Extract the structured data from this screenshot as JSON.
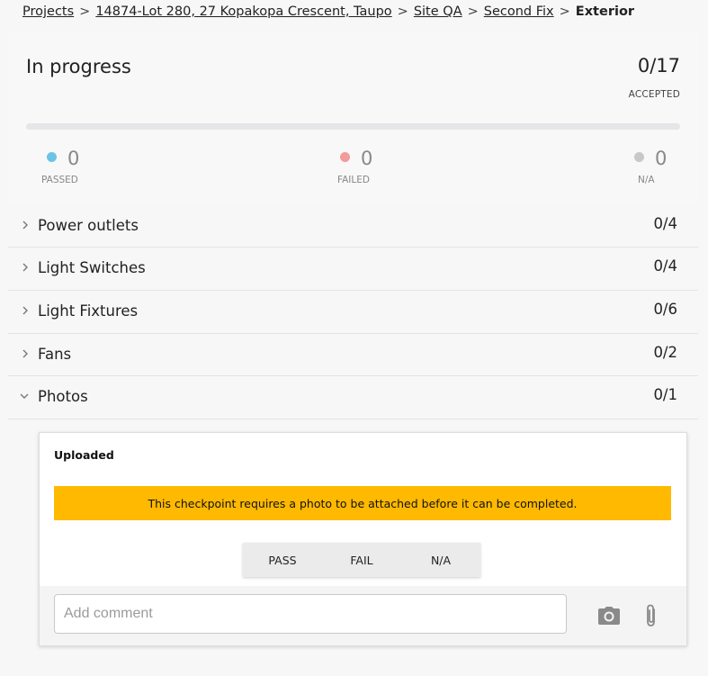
{
  "breadcrumb": {
    "items": [
      "Projects",
      "14874-Lot 280, 27 Kopakopa Crescent, Taupo",
      "Site QA",
      "Second Fix"
    ],
    "separator": ">",
    "current": "Exterior"
  },
  "summary": {
    "status": "In progress",
    "accepted_count": "0/17",
    "accepted_label": "ACCEPTED",
    "progress_fraction": 0,
    "stats": {
      "passed": {
        "value": "0",
        "label": "PASSED",
        "color": "#6cc4e4"
      },
      "failed": {
        "value": "0",
        "label": "FAILED",
        "color": "#f39a9a"
      },
      "na": {
        "value": "0",
        "label": "N/A",
        "color": "#c8c8c8"
      }
    }
  },
  "sections": [
    {
      "name": "Power outlets",
      "count": "0/4",
      "expanded": false
    },
    {
      "name": "Light Switches",
      "count": "0/4",
      "expanded": false
    },
    {
      "name": "Light Fixtures",
      "count": "0/6",
      "expanded": false
    },
    {
      "name": "Fans",
      "count": "0/2",
      "expanded": false
    },
    {
      "name": "Photos",
      "count": "0/1",
      "expanded": true
    }
  ],
  "checkpoint": {
    "status": "Uploaded",
    "warning": "This checkpoint requires a photo to be attached before it can be completed.",
    "warning_color": "#ffb900",
    "buttons": {
      "pass": "PASS",
      "fail": "FAIL",
      "na": "N/A"
    },
    "comment_placeholder": "Add comment",
    "icons": [
      "camera-icon",
      "paperclip-icon"
    ]
  }
}
